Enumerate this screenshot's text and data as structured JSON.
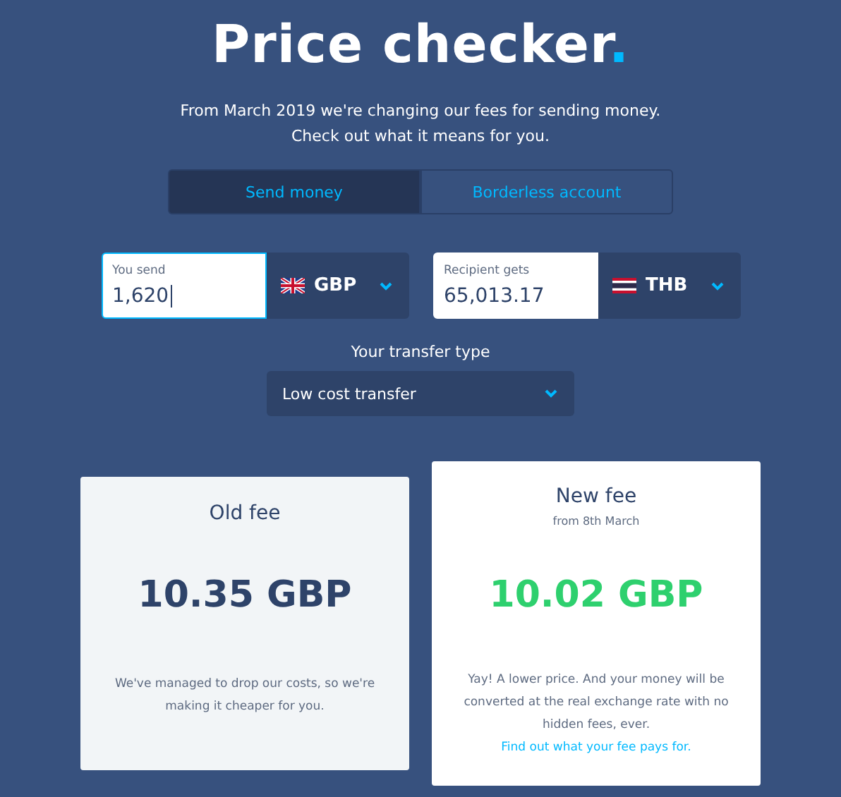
{
  "header": {
    "title": "Price checker",
    "accent": ".",
    "subtitle": [
      "From March 2019 we're changing our fees for sending money.",
      "Check out what it means for you."
    ]
  },
  "tabs": [
    {
      "label": "Send money",
      "selected": true
    },
    {
      "label": "Borderless account",
      "selected": false
    }
  ],
  "converters": [
    {
      "label": "You send",
      "value": "1,620",
      "currency": "GBP",
      "focused": true
    },
    {
      "label": "Recipient gets",
      "value": "65,013.17",
      "currency": "THB",
      "focused": false
    }
  ],
  "transfer_type": {
    "label": "Your transfer type",
    "value": "Low cost transfer"
  },
  "fees": [
    {
      "kind": "old",
      "title": "Old fee",
      "amount": "10.35 GBP",
      "text": "We've managed to drop our costs, so we're making it cheaper for you."
    },
    {
      "kind": "new",
      "title": "New fee",
      "subtitle": "from 8th March",
      "amount": "10.02 GBP",
      "text": "Yay! A lower price. And your money will be converted at the real exchange rate with no hidden fees, ever.",
      "link": "Find out what your fee pays for."
    }
  ]
}
